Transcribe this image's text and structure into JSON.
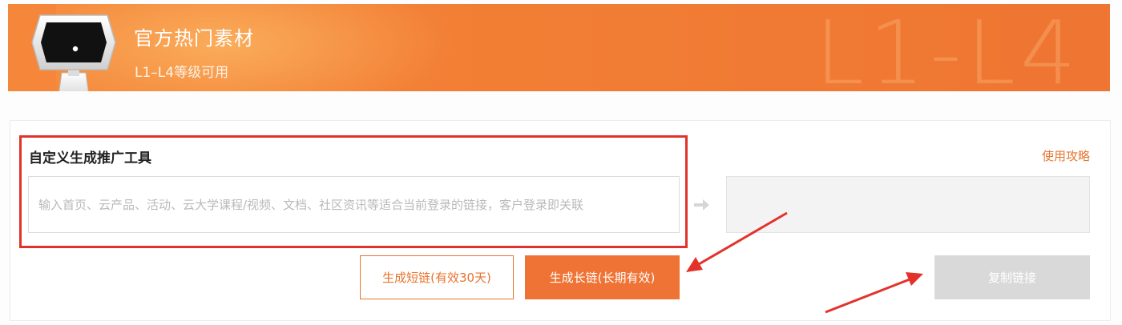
{
  "banner": {
    "title": "官方热门素材",
    "subtitle": "L1–L4等级可用",
    "watermark": "L1-L4"
  },
  "tool": {
    "title": "自定义生成推广工具",
    "guide_link": "使用攻略",
    "input_placeholder": "输入首页、云产品、活动、云大学课程/视频、文档、社区资讯等适合当前登录的链接，客户登录即关联",
    "input_value": "",
    "output_value": "",
    "short_link_button": "生成短链(有效30天)",
    "long_link_button": "生成长链(长期有效)",
    "copy_link_button": "复制链接"
  },
  "colors": {
    "accent": "#ef7334",
    "annotation": "#e2332b",
    "disabled": "#d9d9d9"
  },
  "icons": {
    "arrow": "right-arrow-icon"
  }
}
